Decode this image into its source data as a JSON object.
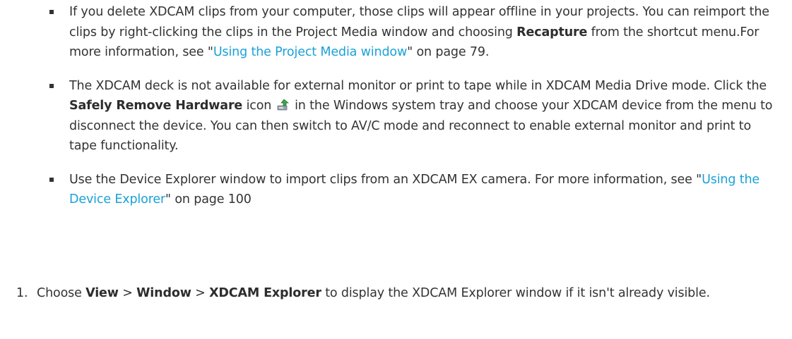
{
  "bullets": [
    {
      "t1": "If you delete XDCAM clips from your computer, those clips will appear offline in your projects. You can reimport the clips by right-clicking the clips in the Project Media window and choosing ",
      "b1": "Recapture",
      "t2": " from the shortcut menu.For more information, see \"",
      "link": "Using the Project Media window",
      "t3": "\" on page 79."
    },
    {
      "t1": "The XDCAM deck is not available for external monitor or print to tape while in XDCAM Media Drive mode. Click the ",
      "b1": "Safely Remove Hardware",
      "t2": " icon",
      "icon": "safely-remove-hardware-icon",
      "t3": " in the Windows system tray and choose your XDCAM device from the menu to disconnect the device. You can then switch to AV/C mode and reconnect to enable external monitor and print to tape functionality."
    },
    {
      "t1": "Use the Device Explorer window to import clips from an XDCAM EX camera. For more information, see \"",
      "link": "Using the Device Explorer",
      "t2": "\" on page 100"
    }
  ],
  "steps": [
    {
      "number": "1.",
      "t1": "Choose ",
      "b1": "View",
      "t2": " > ",
      "b2": "Window",
      "t3": " > ",
      "b3": "XDCAM Explorer",
      "t4": " to display the XDCAM Explorer window if it isn't already visible."
    }
  ],
  "colors": {
    "text": "#333333",
    "link": "#1aa1d8"
  }
}
